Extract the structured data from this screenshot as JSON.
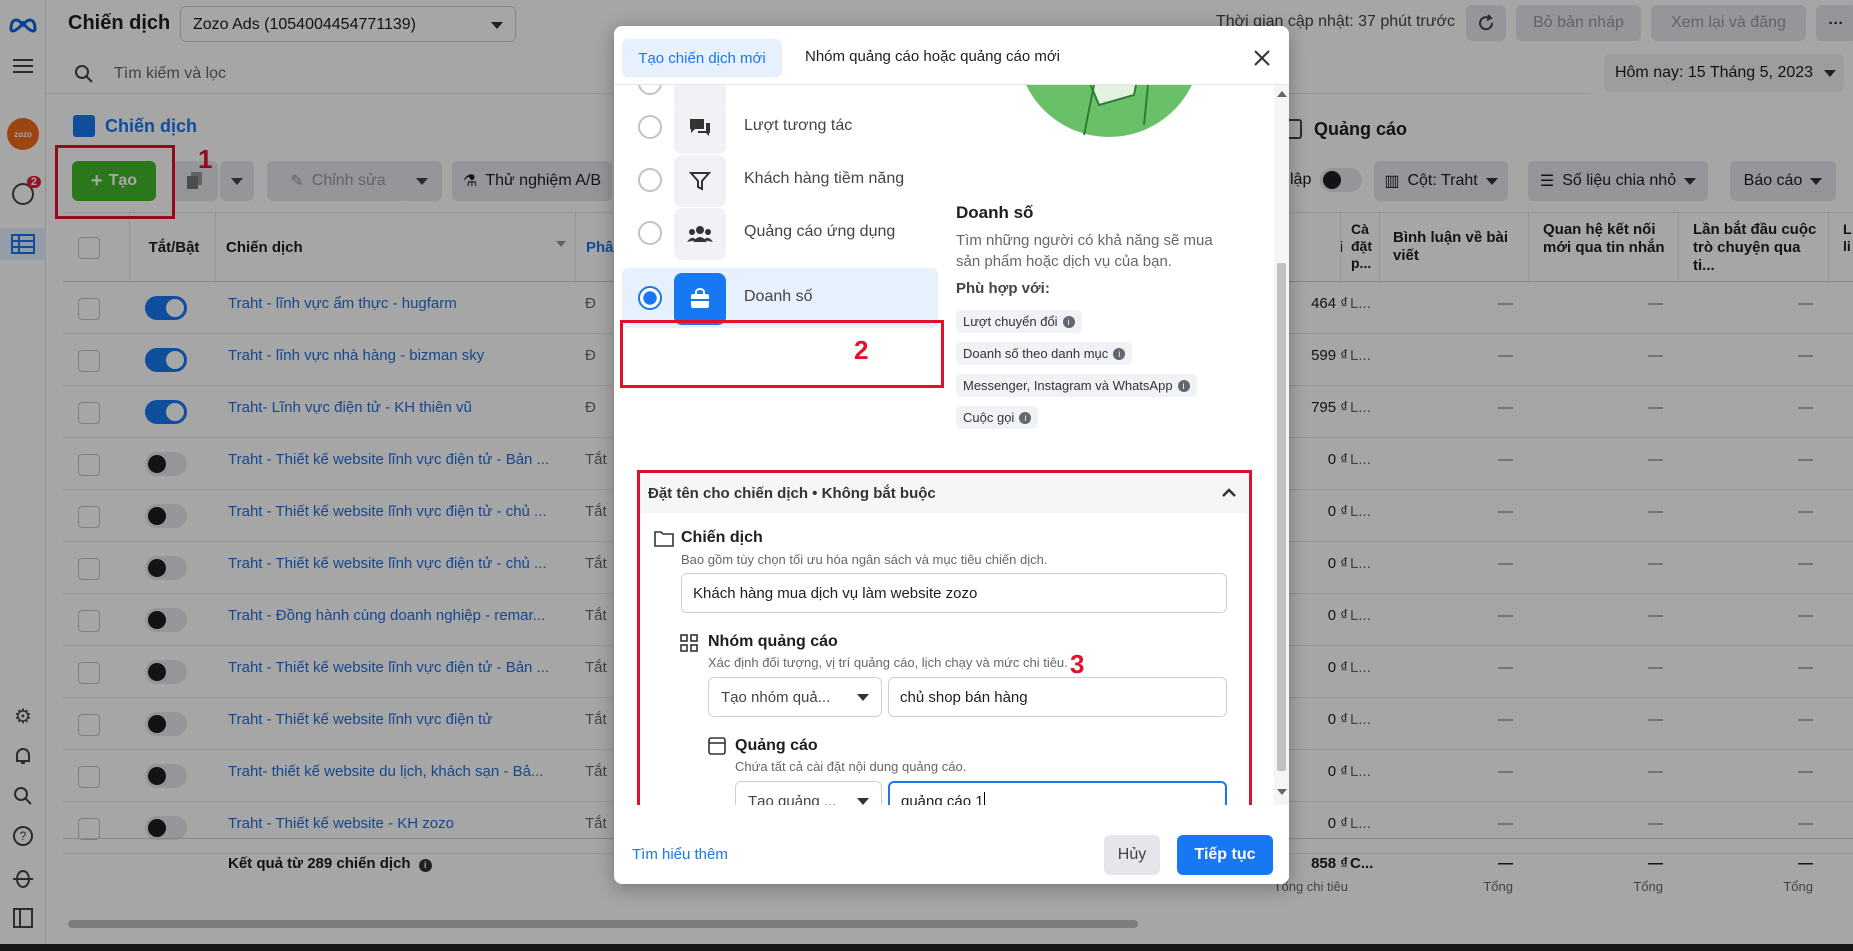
{
  "header": {
    "title": "Chiến dịch",
    "account": "Zozo Ads (1054004454771139)",
    "updated": "Thời gian cập nhật: 37 phút trước",
    "discard_btn": "Bỏ bản nháp",
    "review_btn": "Xem lại và đăng",
    "more": "···"
  },
  "search": {
    "placeholder": "Tìm kiếm và lọc",
    "date": "Hôm nay: 15 Tháng 5, 2023"
  },
  "tabs": {
    "campaigns": "Chiến dịch",
    "ads": "Quảng cáo"
  },
  "rail": {
    "notif_count": "2"
  },
  "toolbar": {
    "create": "Tạo",
    "edit": "Chỉnh sửa",
    "ab_test": "Thử nghiệm A/B",
    "lap": "lập",
    "columns": "Cột: Traht",
    "breakdown": "Số liệu chia nhỏ",
    "reports": "Báo cáo"
  },
  "table": {
    "headers": {
      "toggle": "Tắt/Bật",
      "campaign": "Chiến dịch",
      "delivery": "Phâ",
      "spent": "i",
      "ca": "Cà\nđặt\np...",
      "comments": "Bình luận về bài viết",
      "relations": "Quan hệ kết nối mới qua tin nhắn",
      "first_conv": "Lần bắt đầu cuộc trò chuyện qua ti...",
      "last": "L\nli"
    },
    "rows": [
      {
        "name": "Traht - lĩnh vực ẩm thực - hugfarm",
        "status": "Đ",
        "cost": "464 ₫",
        "tl": "L...",
        "on": true
      },
      {
        "name": "Traht - lĩnh vực nhà hàng - bizman sky",
        "status": "Đ",
        "cost": "599 ₫",
        "tl": "L...",
        "on": true
      },
      {
        "name": "Traht- Lĩnh vực điện tử - KH thiên vũ",
        "status": "Đ",
        "cost": "795 ₫",
        "tl": "L...",
        "on": true
      },
      {
        "name": "Traht - Thiết kế website lĩnh vực điện tử - Bản ...",
        "status": "Tắt",
        "cost": "0 ₫",
        "tl": "L...",
        "on": false
      },
      {
        "name": "Traht - Thiết kế website lĩnh vực điện tử - chủ ...",
        "status": "Tắt",
        "cost": "0 ₫",
        "tl": "L...",
        "on": false
      },
      {
        "name": "Traht - Thiết kế website lĩnh vực điện tử - chủ ...",
        "status": "Tắt",
        "cost": "0 ₫",
        "tl": "L...",
        "on": false
      },
      {
        "name": "Traht - Đồng hành cùng doanh nghiệp - remar...",
        "status": "Tắt",
        "cost": "0 ₫",
        "tl": "L...",
        "on": false
      },
      {
        "name": "Traht - Thiết kế website lĩnh vực điện tử - Bản ...",
        "status": "Tắt",
        "cost": "0 ₫",
        "tl": "L...",
        "on": false
      },
      {
        "name": "Traht - Thiết kế website lĩnh vực điện tử",
        "status": "Tắt",
        "cost": "0 ₫",
        "tl": "L...",
        "on": false
      },
      {
        "name": "Traht- thiết kế website du lịch, khách sạn - Bả...",
        "status": "Tắt",
        "cost": "0 ₫",
        "tl": "L...",
        "on": false
      },
      {
        "name": "Traht - Thiết kế website - KH zozo",
        "status": "Tắt",
        "cost": "0 ₫",
        "tl": "L...",
        "on": false
      }
    ],
    "dash": "—",
    "footer": {
      "results": "Kết quả từ 289 chiến dịch",
      "total_cost": "858 ₫",
      "total_cost_label": "Tổng chi tiêu",
      "c": "C...",
      "total": "Tổng"
    }
  },
  "modal": {
    "tab_new": "Tạo chiến dịch mới",
    "tab_existing": "Nhóm quảng cáo hoặc quảng cáo mới",
    "objectives": [
      {
        "label": "Lượt tương tác",
        "icon": "chat-bubbles-icon"
      },
      {
        "label": "Khách hàng tiềm năng",
        "icon": "funnel-icon"
      },
      {
        "label": "Quảng cáo ứng dụng",
        "icon": "people-icon"
      },
      {
        "label": "Doanh số",
        "icon": "shopping-bag-icon"
      }
    ],
    "detail": {
      "title": "Doanh số",
      "desc": "Tìm những người có khả năng sẽ mua sản phẩm hoặc dịch vụ của bạn.",
      "fit_label": "Phù hợp với:",
      "tags": [
        "Lượt chuyển đổi",
        "Doanh số theo danh mục",
        "Messenger, Instagram và WhatsApp",
        "Cuộc gọi"
      ]
    },
    "naming": {
      "header": "Đặt tên cho chiến dịch • Không bắt buộc",
      "campaign_label": "Chiến dịch",
      "campaign_desc": "Bao gồm tùy chọn tối ưu hóa ngân sách và mục tiêu chiến dịch.",
      "campaign_value": "Khách hàng mua dịch vụ làm website zozo",
      "adset_label": "Nhóm quảng cáo",
      "adset_desc": "Xác định đối tượng, vị trí quảng cáo, lịch chạy và mức chi tiêu.",
      "adset_select": "Tạo nhóm quả...",
      "adset_value": "chủ shop bán hàng",
      "ad_label": "Quảng cáo",
      "ad_desc": "Chứa tất cả cài đặt nội dung quảng cáo.",
      "ad_select": "Tạo quảng ...",
      "ad_value": "quảng cáo 1"
    },
    "learn_more": "Tìm hiểu thêm",
    "cancel": "Hủy",
    "continue": "Tiếp tục"
  },
  "annotations": {
    "n1": "1",
    "n2": "2",
    "n3": "3"
  },
  "colors": {
    "accent": "#1877f2",
    "create_green": "#42b72a",
    "annotation_red": "#e3102a"
  }
}
